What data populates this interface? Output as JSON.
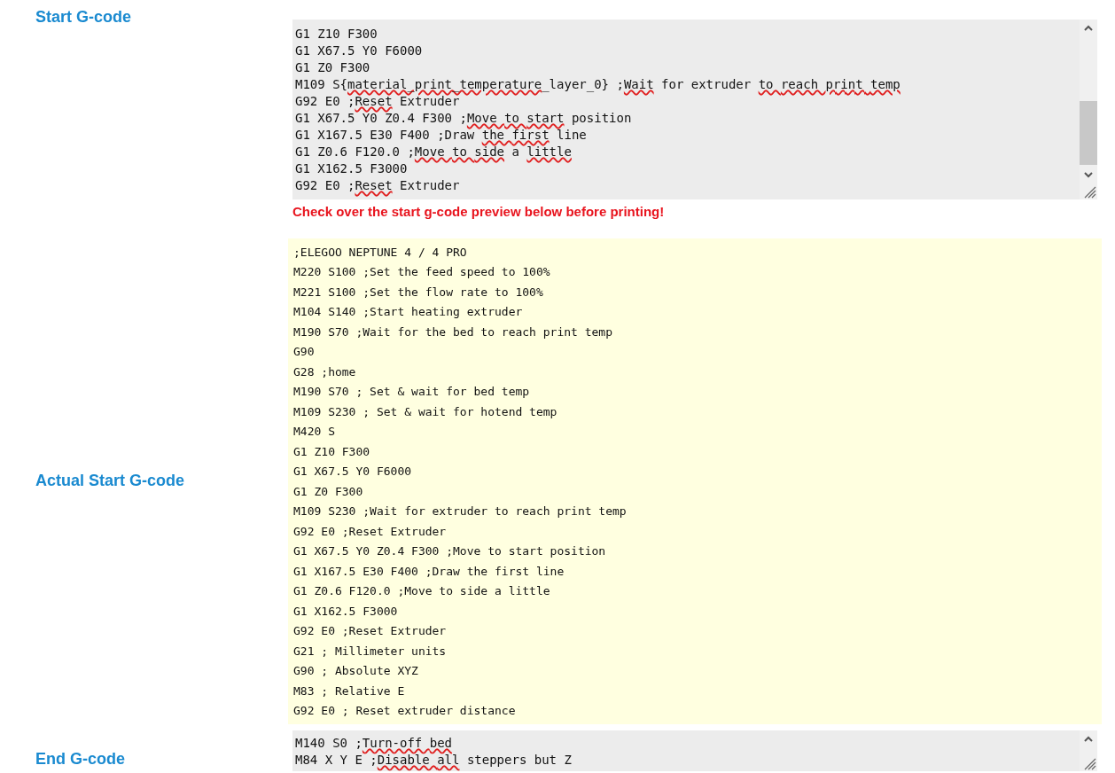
{
  "start_gcode": {
    "label": "Start G-code",
    "lines": [
      [
        {
          "text": "G1 Z10 F300",
          "misspelled": false
        }
      ],
      [
        {
          "text": "G1 X67.5 Y0 F6000",
          "misspelled": false
        }
      ],
      [
        {
          "text": "G1 Z0 F300",
          "misspelled": false
        }
      ],
      [
        {
          "text": "M109 S{",
          "misspelled": false
        },
        {
          "text": "material_print_temperature",
          "misspelled": true
        },
        {
          "text": "_layer_0} ;",
          "misspelled": false
        },
        {
          "text": "Wait",
          "misspelled": true
        },
        {
          "text": " for extruder ",
          "misspelled": false
        },
        {
          "text": "to ",
          "misspelled": true
        },
        {
          "text": "reach ",
          "misspelled": true
        },
        {
          "text": "print ",
          "misspelled": true
        },
        {
          "text": "temp",
          "misspelled": true
        }
      ],
      [
        {
          "text": "G92 E0 ;",
          "misspelled": false
        },
        {
          "text": "Reset",
          "misspelled": true
        },
        {
          "text": " Extruder",
          "misspelled": false
        }
      ],
      [
        {
          "text": "G1 X67.5 Y0 Z0.4 F300 ;",
          "misspelled": false
        },
        {
          "text": "Move ",
          "misspelled": true
        },
        {
          "text": "to ",
          "misspelled": true
        },
        {
          "text": "start",
          "misspelled": true
        },
        {
          "text": " position",
          "misspelled": false
        }
      ],
      [
        {
          "text": "G1 X167.5 E30 F400 ;Draw ",
          "misspelled": false
        },
        {
          "text": "the ",
          "misspelled": true
        },
        {
          "text": "first",
          "misspelled": true
        },
        {
          "text": " line",
          "misspelled": false
        }
      ],
      [
        {
          "text": "G1 Z0.6 F120.0 ;",
          "misspelled": false
        },
        {
          "text": "Move ",
          "misspelled": true
        },
        {
          "text": "to ",
          "misspelled": true
        },
        {
          "text": "side",
          "misspelled": true
        },
        {
          "text": " a ",
          "misspelled": false
        },
        {
          "text": "little",
          "misspelled": true
        }
      ],
      [
        {
          "text": "G1 X162.5 F3000",
          "misspelled": false
        }
      ],
      [
        {
          "text": "G92 E0 ;",
          "misspelled": false
        },
        {
          "text": "Reset",
          "misspelled": true
        },
        {
          "text": " Extruder",
          "misspelled": false
        }
      ]
    ],
    "warning": "Check over the start g-code preview below before printing!"
  },
  "actual_start_gcode": {
    "label": "Actual Start G-code",
    "lines": [
      ";ELEGOO NEPTUNE 4 / 4 PRO",
      "M220 S100 ;Set the feed speed to 100%",
      "M221 S100 ;Set the flow rate to 100%",
      "M104 S140 ;Start heating extruder",
      "M190 S70 ;Wait for the bed to reach print temp",
      "G90",
      "G28 ;home",
      "M190 S70 ; Set & wait for bed temp",
      "M109 S230 ; Set & wait for hotend temp",
      "M420 S",
      "G1 Z10 F300",
      "G1 X67.5 Y0 F6000",
      "G1 Z0 F300",
      "M109 S230 ;Wait for extruder to reach print temp",
      "G92 E0 ;Reset Extruder",
      "G1 X67.5 Y0 Z0.4 F300 ;Move to start position",
      "G1 X167.5 E30 F400 ;Draw the first line",
      "G1 Z0.6 F120.0 ;Move to side a little",
      "G1 X162.5 F3000",
      "G92 E0 ;Reset Extruder",
      "G21 ; Millimeter units",
      "G90 ; Absolute XYZ",
      "M83 ; Relative E",
      "G92 E0 ; Reset extruder distance"
    ]
  },
  "end_gcode": {
    "label": "End G-code",
    "lines": [
      [
        {
          "text": "M140 S0 ;",
          "misspelled": false
        },
        {
          "text": "Turn-off ",
          "misspelled": true
        },
        {
          "text": "bed",
          "misspelled": true
        }
      ],
      [
        {
          "text": "M84 X Y E ;",
          "misspelled": false
        },
        {
          "text": "Disable ",
          "misspelled": true
        },
        {
          "text": "all",
          "misspelled": true
        },
        {
          "text": " steppers but Z",
          "misspelled": false
        }
      ]
    ]
  }
}
